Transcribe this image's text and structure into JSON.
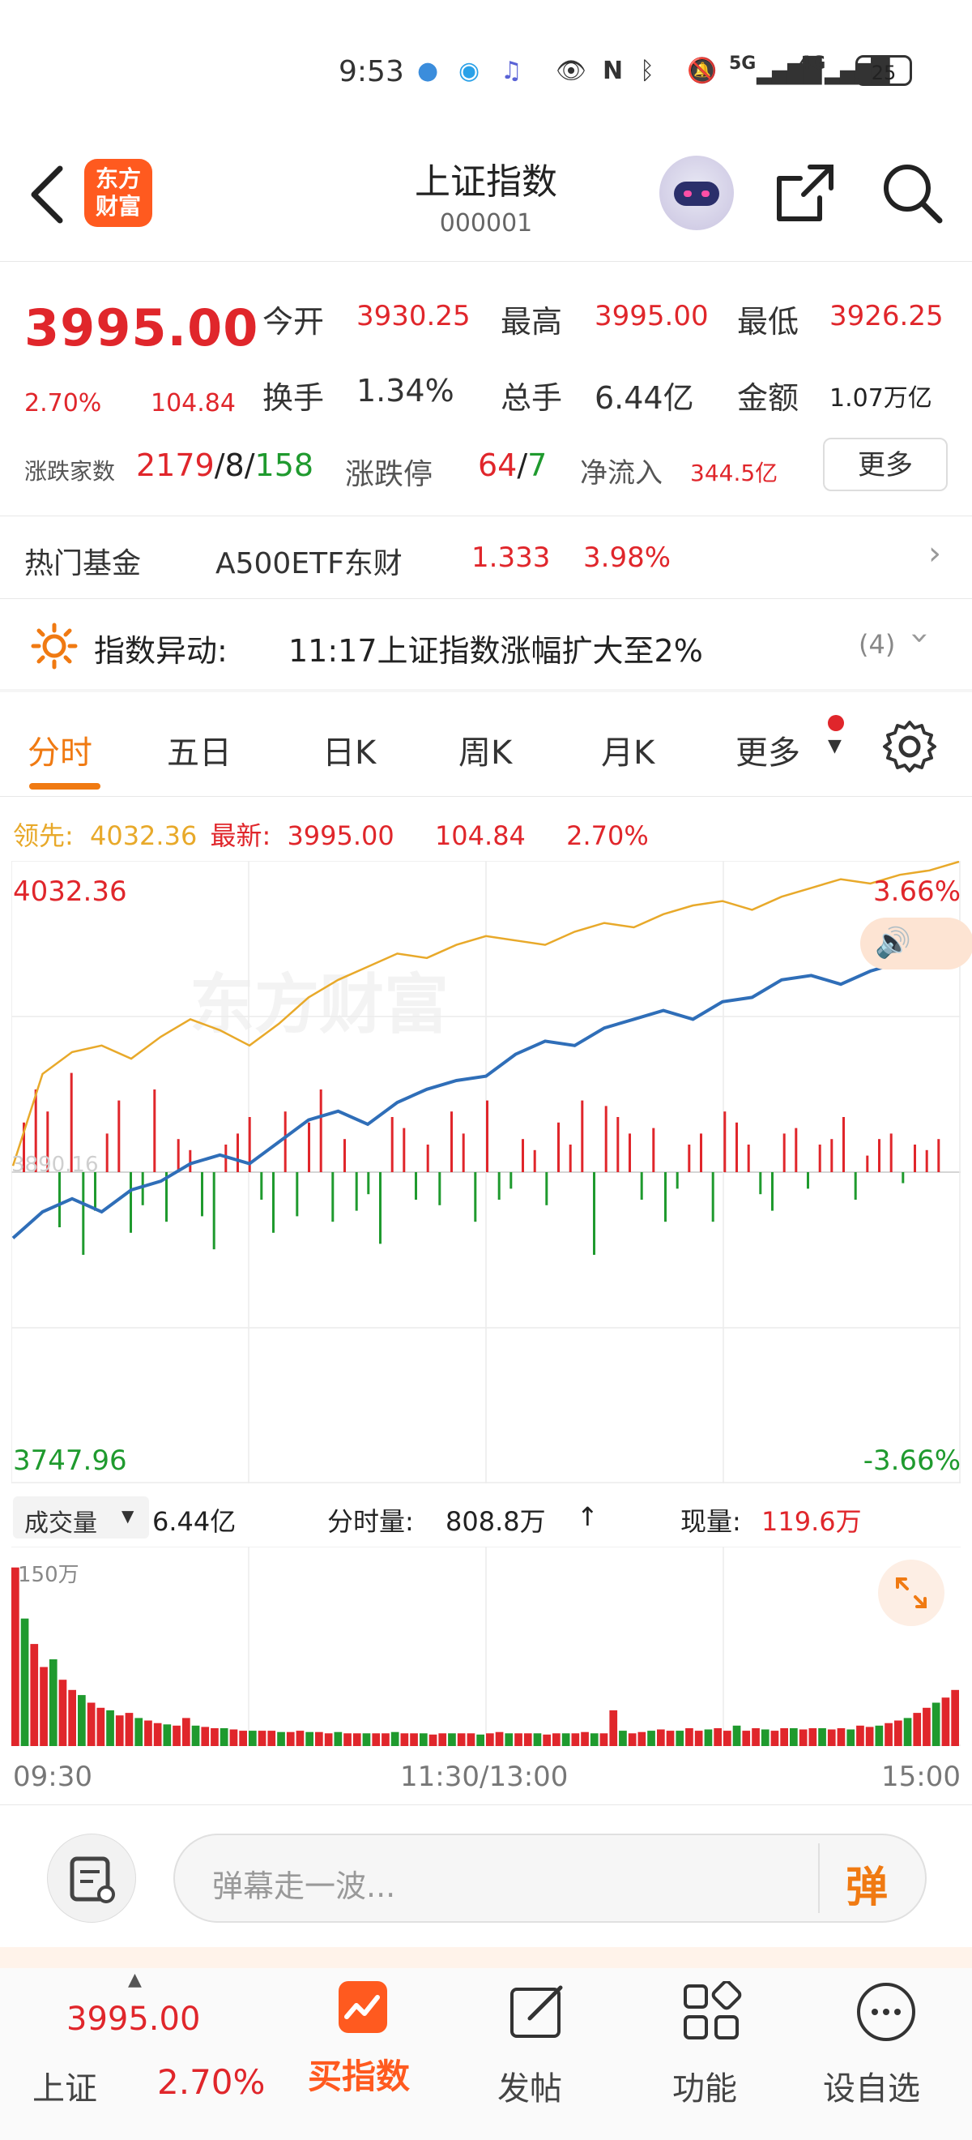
{
  "status_bar": {
    "time": "9:53",
    "network_1": "5G",
    "network_2": "4G",
    "battery": "25"
  },
  "header": {
    "logo_text": "东方\n财富",
    "title": "上证指数",
    "code": "000001"
  },
  "quote": {
    "price": "3995.00",
    "change_pct": "2.70%",
    "change": "104.84",
    "open_label": "今开",
    "open": "3930.25",
    "high_label": "最高",
    "high": "3995.00",
    "low_label": "最低",
    "low": "3926.25",
    "turnover_label": "换手",
    "turnover": "1.34%",
    "volume_label": "总手",
    "volume": "6.44亿",
    "amount_label": "金额",
    "amount": "1.07万亿",
    "breadth_label": "涨跌家数",
    "breadth_up": "2179",
    "breadth_sep1": "/",
    "breadth_flat": "8",
    "breadth_sep2": "/",
    "breadth_down": "158",
    "limit_label": "涨跌停",
    "limit_up": "64",
    "limit_sep": "/",
    "limit_down": "7",
    "inflow_label": "净流入",
    "inflow": "344.5亿",
    "more_label": "更多"
  },
  "hot_fund": {
    "label": "热门基金",
    "name": "A500ETF东财",
    "price": "1.333",
    "pct": "3.98%"
  },
  "alert": {
    "label": "指数异动:",
    "text": "11:17上证指数涨幅扩大至2%",
    "count": "(4)"
  },
  "tabs": [
    "分时",
    "五日",
    "日K",
    "周K",
    "月K",
    "更多"
  ],
  "legend": {
    "lead_label": "领先:",
    "lead_value": "4032.36",
    "latest_label": "最新:",
    "latest_value": "3995.00",
    "change": "104.84",
    "pct": "2.70%"
  },
  "chart_data": {
    "type": "line",
    "y_top": "4032.36",
    "y_bottom": "3747.96",
    "pct_top": "3.66%",
    "pct_bottom": "-3.66%",
    "mid_label": "3890.16",
    "ylim": [
      3747.96,
      4032.36
    ],
    "lead_series": [
      3893,
      3935,
      3945,
      3948,
      3942,
      3952,
      3960,
      3955,
      3948,
      3958,
      3970,
      3978,
      3984,
      3990,
      3988,
      3994,
      3998,
      3996,
      3994,
      4000,
      4004,
      4002,
      4008,
      4012,
      4014,
      4010,
      4016,
      4020,
      4024,
      4022,
      4026,
      4028,
      4032
    ],
    "latest_series": [
      3860,
      3872,
      3878,
      3872,
      3882,
      3886,
      3894,
      3898,
      3894,
      3904,
      3914,
      3918,
      3912,
      3922,
      3928,
      3932,
      3934,
      3944,
      3950,
      3948,
      3956,
      3960,
      3964,
      3960,
      3968,
      3970,
      3978,
      3980,
      3976,
      3982,
      3986,
      3992,
      3995
    ],
    "bars": [
      18,
      30,
      22,
      -20,
      36,
      -30,
      -14,
      14,
      26,
      -22,
      -12,
      30,
      -18,
      12,
      8,
      -16,
      -28,
      10,
      14,
      20,
      -10,
      -22,
      22,
      -16,
      18,
      30,
      -18,
      12,
      -14,
      -8,
      -26,
      20,
      16,
      -10,
      10,
      -12,
      22,
      14,
      -18,
      26,
      -10,
      -6,
      12,
      8,
      -12,
      18,
      10,
      26,
      -30,
      24,
      20,
      14,
      -10,
      16,
      -18,
      -6,
      10,
      14,
      -18,
      22,
      18,
      10,
      -8,
      -14,
      14,
      16,
      -6,
      10,
      12,
      20,
      -10,
      6,
      12,
      14,
      -4,
      10,
      8,
      12
    ]
  },
  "volume_header": {
    "selector": "成交量",
    "total": "6.44亿",
    "minute_label": "分时量:",
    "minute_value": "808.8万",
    "arrow": "↑",
    "now_label": "现量:",
    "now_value": "119.6万",
    "scale": "150万"
  },
  "volume_data": {
    "values": [
      140,
      100,
      80,
      62,
      68,
      52,
      44,
      40,
      34,
      30,
      28,
      24,
      26,
      22,
      20,
      18,
      17,
      16,
      22,
      16,
      15,
      14,
      14,
      13,
      12,
      12,
      12,
      12,
      11,
      11,
      12,
      11,
      11,
      10,
      11,
      10,
      10,
      10,
      10,
      10,
      11,
      10,
      10,
      10,
      9,
      10,
      10,
      10,
      10,
      9,
      10,
      11,
      10,
      10,
      10,
      10,
      9,
      10,
      10,
      10,
      11,
      10,
      10,
      28,
      12,
      10,
      11,
      12,
      13,
      12,
      12,
      14,
      12,
      13,
      14,
      12,
      16,
      12,
      14,
      13,
      12,
      14,
      14,
      13,
      14,
      14,
      13,
      14,
      13,
      16,
      15,
      16,
      18,
      20,
      22,
      26,
      30,
      34,
      38,
      44
    ],
    "colors_red_green_pattern": "mixed"
  },
  "time_axis": {
    "start": "09:30",
    "mid": "11:30/13:00",
    "end": "15:00"
  },
  "comment_bar": {
    "placeholder": "弹幕走一波...",
    "danmu_label": "弹"
  },
  "bottom_nav": {
    "ticker_price": "3995.00",
    "ticker_name": "上证",
    "ticker_pct": "2.70%",
    "buy_label": "买指数",
    "post_label": "发帖",
    "features_label": "功能",
    "watch_label": "设自选"
  },
  "colors": {
    "accent": "#f07a12",
    "up": "#e0262b",
    "down": "#1f9a2e",
    "line_lead": "#e8a92a",
    "line_latest": "#2f6eb8"
  }
}
